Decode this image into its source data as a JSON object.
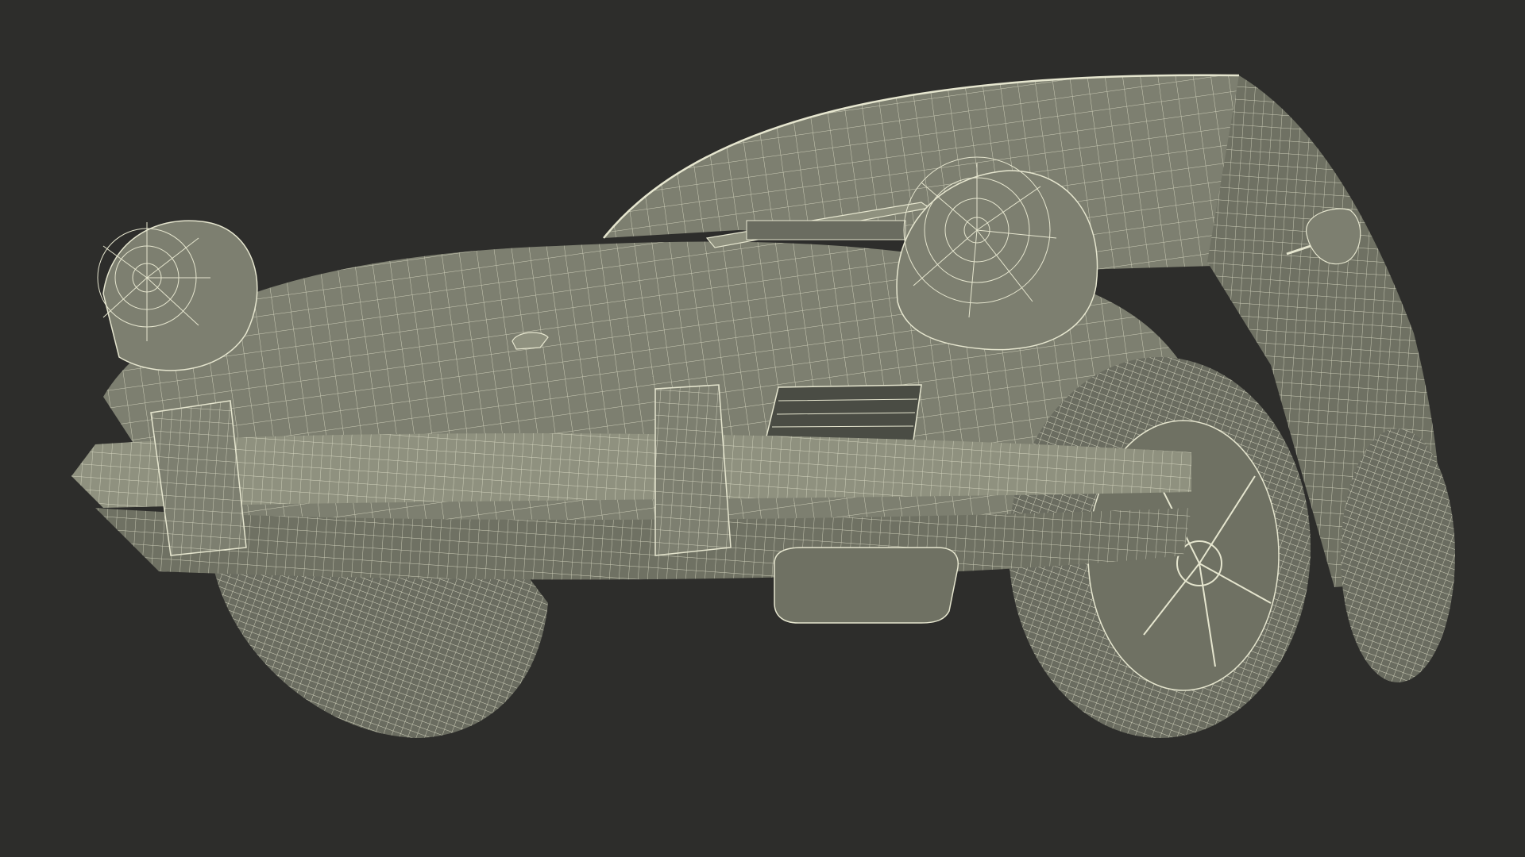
{
  "scene": {
    "subject_icon": "car-wireframe-icon",
    "render_style": "wireframe",
    "colors": {
      "background": "#2d2d2b",
      "surface": "#7d7f70",
      "surface_shadow": "#5f6157",
      "surface_light": "#8f917f",
      "wire": "#e6e6cf",
      "dark_gap": "#4a4c44"
    }
  }
}
